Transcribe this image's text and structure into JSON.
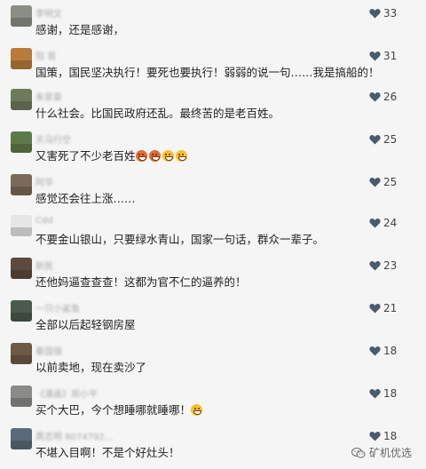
{
  "comments": [
    {
      "name": "李明文",
      "text": "感谢，还是感谢，",
      "likes": "33",
      "avatar_color": "#8a8f86"
    },
    {
      "name": "阳 哥",
      "text": "国策，国民坚决执行！要死也要执行！弱弱的说一句……我是搞船的！",
      "likes": "31",
      "avatar_color": "#b87b3a"
    },
    {
      "name": "朱家豪",
      "text": "什么社会。比国民政府还乱。最终苦的是老百姓。",
      "likes": "26",
      "avatar_color": "#6f7a5c"
    },
    {
      "name": "天马行空",
      "text": "又害死了不少老百姓",
      "likes": "25",
      "avatar_color": "#5e7a4a",
      "emojis": [
        "angry",
        "angry",
        "grin",
        "grin"
      ]
    },
    {
      "name": "阿华",
      "text": "感觉还会往上涨……",
      "likes": "25",
      "avatar_color": "#7c6a58"
    },
    {
      "name": "Cdd",
      "text": "不要金山银山，只要绿水青山，国家一句话，群众一辈子。",
      "likes": "24",
      "avatar_color": "#e6e6e6"
    },
    {
      "name": "新民",
      "text": "还他妈逼查查查！这都为官不仁的逼养的！",
      "likes": "23",
      "avatar_color": "#5d4a3c"
    },
    {
      "name": "一只小鲨鱼",
      "text": "全部以后起轻钢房屋",
      "likes": "21",
      "avatar_color": "#4b5a4a"
    },
    {
      "name": "秦国强",
      "text": "以前卖地，现在卖沙了",
      "likes": "18",
      "avatar_color": "#6d5a46"
    },
    {
      "name": "《漫画》郑小平",
      "text": "买个大巴，今个想睡哪就睡哪！",
      "likes": "18",
      "avatar_color": "#8a8a86",
      "emojis": [
        "grin"
      ]
    },
    {
      "name": "黄志明 8074792...",
      "text": "不堪入目啊！不是个好灶头！",
      "likes": "18",
      "avatar_color": "#5a6a7a"
    }
  ],
  "watermark": {
    "text": "矿机优选",
    "icon": "wechat-icon"
  },
  "colors": {
    "heart": "#4a5b6b",
    "count": "#444444",
    "name": "#a9a9a9"
  }
}
